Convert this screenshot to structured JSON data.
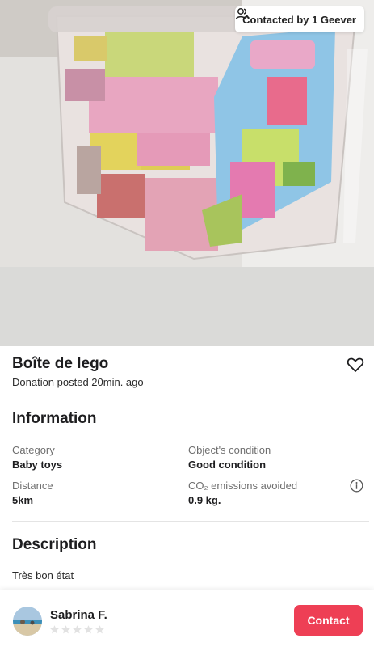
{
  "listing": {
    "badge": {
      "text": "Contacted by 1 Geever",
      "icon": "people-icon"
    },
    "photo": {
      "icon": "product-photo"
    },
    "title": "Boîte de lego",
    "posted": "Donation posted 20min. ago",
    "favorite_icon": "heart-icon"
  },
  "information": {
    "title": "Information",
    "category": {
      "label": "Category",
      "value": "Baby toys"
    },
    "condition": {
      "label": "Object's condition",
      "value": "Good condition"
    },
    "distance": {
      "label": "Distance",
      "value": "5km"
    },
    "co2": {
      "label": "CO₂ emissions avoided",
      "value": "0.9 kg.",
      "icon": "info-icon"
    }
  },
  "description": {
    "title": "Description",
    "text": "Très bon état"
  },
  "footer": {
    "user_name": "Sabrina F.",
    "rating": {
      "value": 0,
      "max": 5
    },
    "contact_label": "Contact"
  },
  "colors": {
    "accent": "#ee3f55",
    "text": "#1d1d1f",
    "muted": "#6f6f6f",
    "star_empty": "#e2e2e2"
  }
}
